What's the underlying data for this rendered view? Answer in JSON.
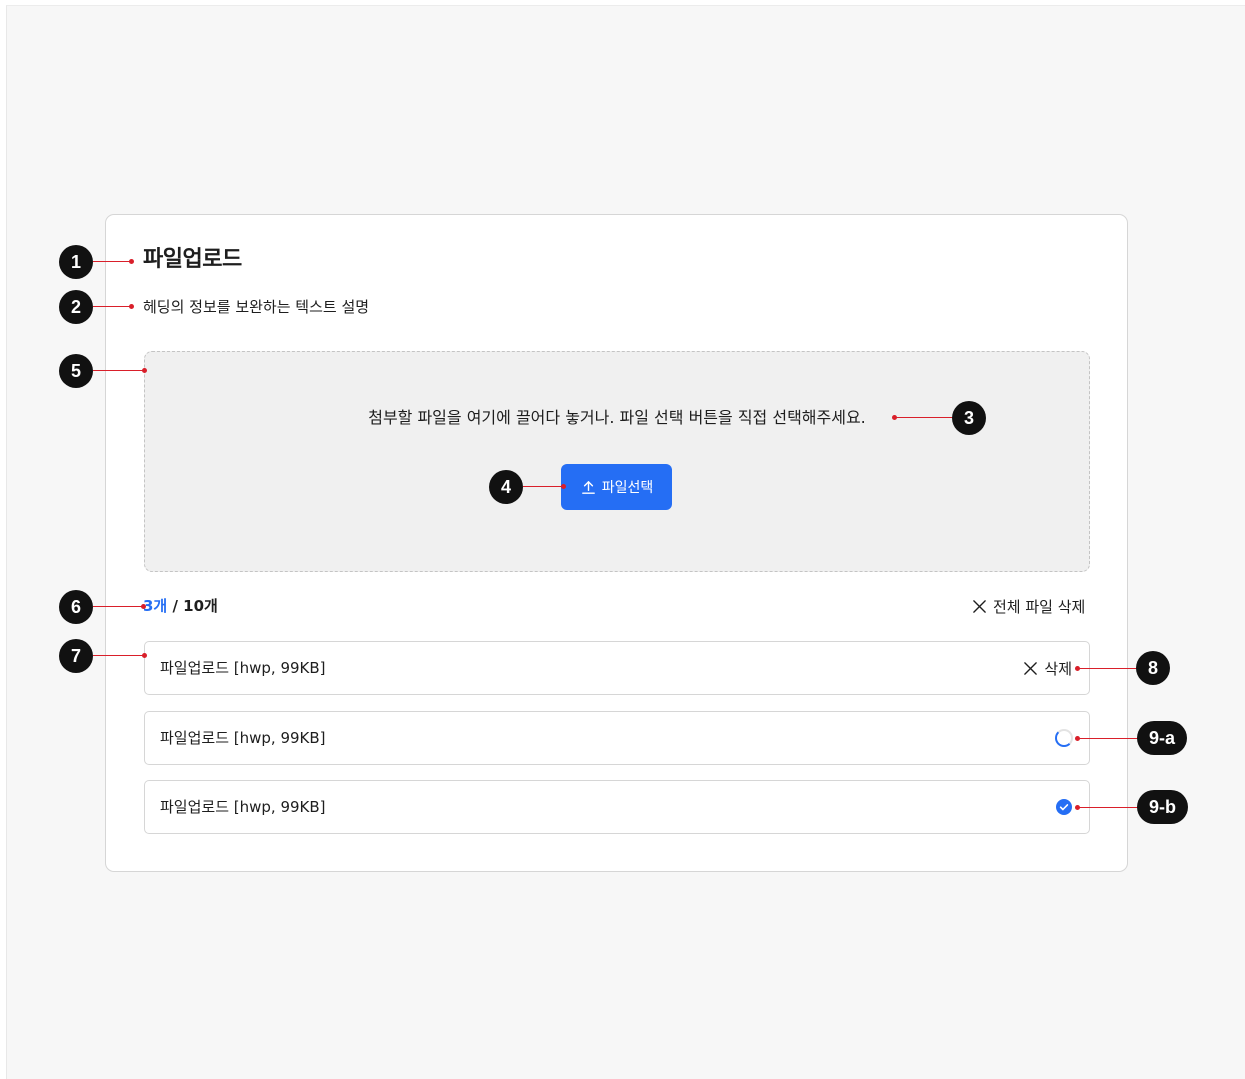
{
  "upload": {
    "title": "파일업로드",
    "description": "헤딩의 정보를 보완하는 텍스트 설명",
    "drop_text": "첨부할 파일을 여기에 끌어다 놓거나. 파일 선택 버튼을 직접 선택해주세요.",
    "select_button_label": "파일선택",
    "count_current": "3개",
    "count_max": " / 10개",
    "delete_all_label": "전체 파일 삭제",
    "files": [
      {
        "name": "파일업로드 [hwp, 99KB]",
        "state": "uploaded",
        "delete_label": "삭제"
      },
      {
        "name": "파일업로드 [hwp, 99KB]",
        "state": "uploading"
      },
      {
        "name": "파일업로드 [hwp, 99KB]",
        "state": "complete"
      }
    ]
  },
  "annotations": {
    "m1": "1",
    "m2": "2",
    "m3": "3",
    "m4": "4",
    "m5": "5",
    "m6": "6",
    "m7": "7",
    "m8": "8",
    "m9a": "9-a",
    "m9b": "9-b"
  },
  "colors": {
    "accent": "#256ef4",
    "annotation_line": "#d91f2a",
    "marker": "#111111"
  }
}
